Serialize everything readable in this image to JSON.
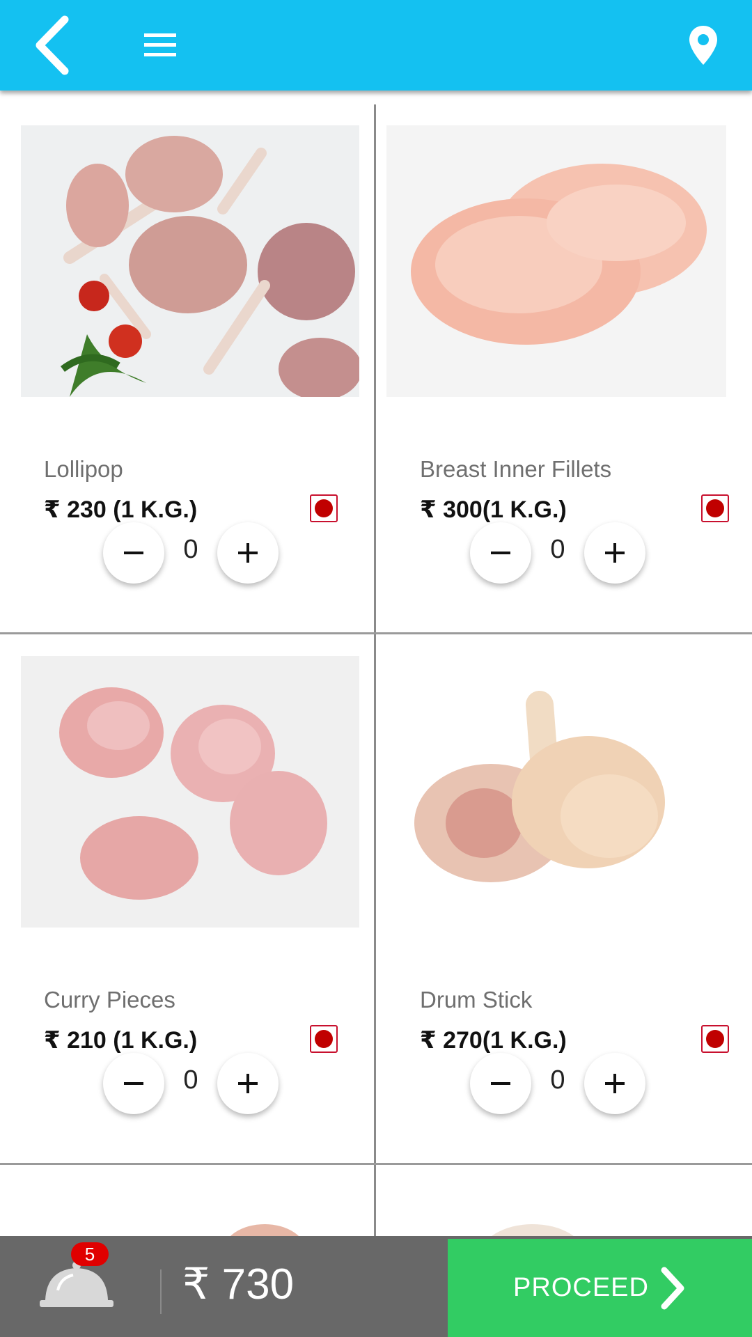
{
  "header": {
    "back_icon": "chevron-left-icon",
    "menu_icon": "hamburger-menu-icon",
    "location_icon": "map-pin-icon",
    "color": "#14c1f1"
  },
  "products": [
    {
      "name": "Lollipop",
      "price": "₹ 230 (1 K.G.)",
      "qty": "0"
    },
    {
      "name": "Breast Inner Fillets",
      "price": "₹ 300(1 K.G.)",
      "qty": "0"
    },
    {
      "name": "Curry Pieces",
      "price": "₹ 210 (1 K.G.)",
      "qty": "0"
    },
    {
      "name": "Drum Stick",
      "price": "₹ 270(1 K.G.)",
      "qty": "0"
    }
  ],
  "footer": {
    "cart_icon": "serving-bell-icon",
    "cart_count": "5",
    "total": "₹ 730",
    "proceed_label": "PROCEED",
    "proceed_color": "#32cc63"
  }
}
